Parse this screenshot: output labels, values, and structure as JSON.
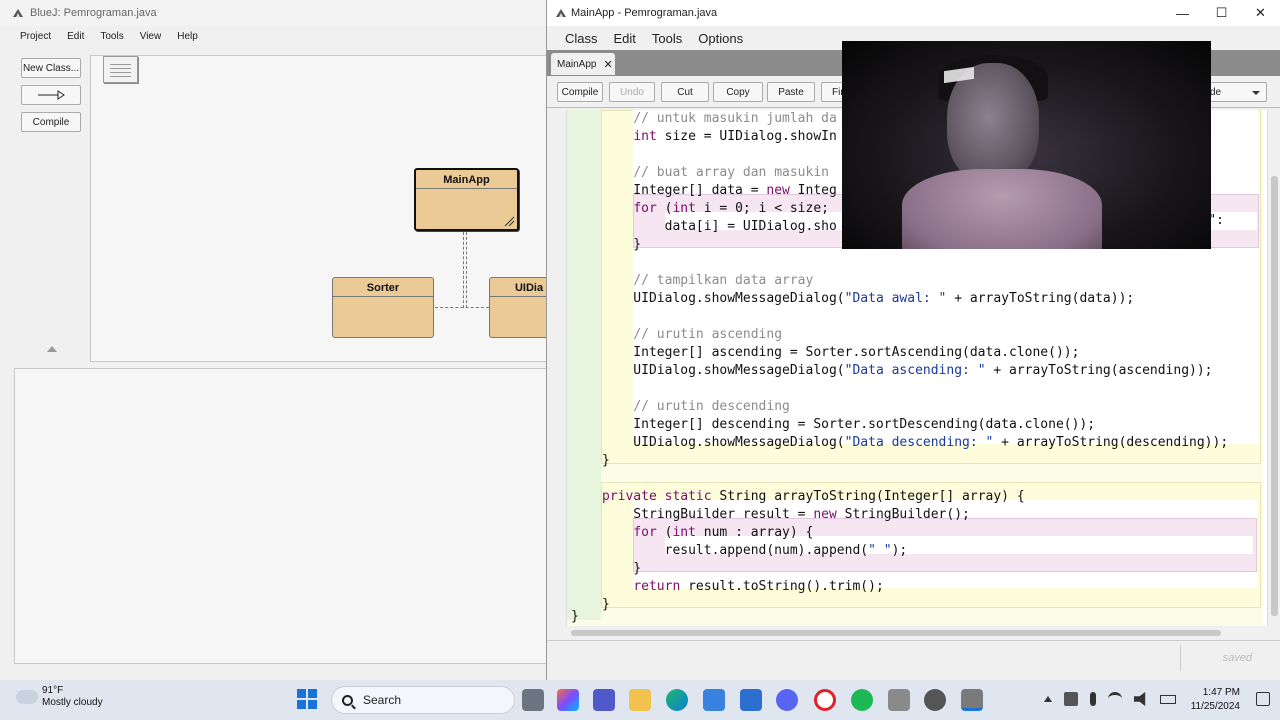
{
  "bluej": {
    "title": "BlueJ:  Pemrograman.java",
    "menu": [
      "Project",
      "Edit",
      "Tools",
      "View",
      "Help"
    ],
    "buttons": {
      "new_class": "New Class...",
      "compile": "Compile"
    },
    "classes": {
      "main": "MainApp",
      "sorter": "Sorter",
      "uidialog": "UIDia"
    }
  },
  "editor": {
    "title": "MainApp - Pemrograman.java",
    "menu": [
      "Class",
      "Edit",
      "Tools",
      "Options"
    ],
    "tab_label": "MainApp",
    "toolbar": {
      "compile": "Compile",
      "undo": "Undo",
      "cut": "Cut",
      "copy": "Copy",
      "paste": "Paste",
      "find": "Fin",
      "view_select": "de"
    },
    "status": "saved"
  },
  "code": [
    "    // untuk masukin jumlah da",
    "    int size = UIDialog.showIn",
    "",
    "    // buat array dan masukin",
    "    Integer[] data = new Integ",
    "    for (int i = 0; i < size;",
    "        data[i] = UIDialog.sho",
    "    }",
    "",
    "    // tampilkan data array",
    "    UIDialog.showMessageDialog(\"Data awal: \" + arrayToString(data));",
    "",
    "    // urutin ascending",
    "    Integer[] ascending = Sorter.sortAscending(data.clone());",
    "    UIDialog.showMessageDialog(\"Data ascending: \" + arrayToString(ascending));",
    "",
    "    // urutin descending",
    "    Integer[] descending = Sorter.sortDescending(data.clone());",
    "    UIDialog.showMessageDialog(\"Data descending: \" + arrayToString(descending));",
    "}",
    "",
    "private static String arrayToString(Integer[] array) {",
    "    StringBuilder result = new StringBuilder();",
    "    for (int num : array) {",
    "        result.append(num).append(\" \");",
    "    }",
    "    return result.toString().trim();",
    "}"
  ],
  "code_extra": {
    "line7_tail": ") + \":",
    "closing_brace": "}"
  },
  "taskbar": {
    "temperature": "91°F",
    "weather": "Mostly cloudy",
    "search_placeholder": "Search",
    "time": "1:47 PM",
    "date": "11/25/2024"
  },
  "colors": {
    "class_fill": "#ecca96",
    "keyword": "#7a0e6e",
    "comment": "#8c8c8c",
    "string": "#1a3a9a",
    "taskbar": "#dfe6ef"
  },
  "icons": [
    "bluej-app-icon",
    "windows-start-icon",
    "search-icon",
    "file-explorer-icon",
    "edge-icon",
    "store-icon",
    "discord-icon",
    "opera-icon",
    "spotify-icon",
    "chrome-icon",
    "wifi-icon",
    "volume-icon",
    "battery-icon"
  ]
}
